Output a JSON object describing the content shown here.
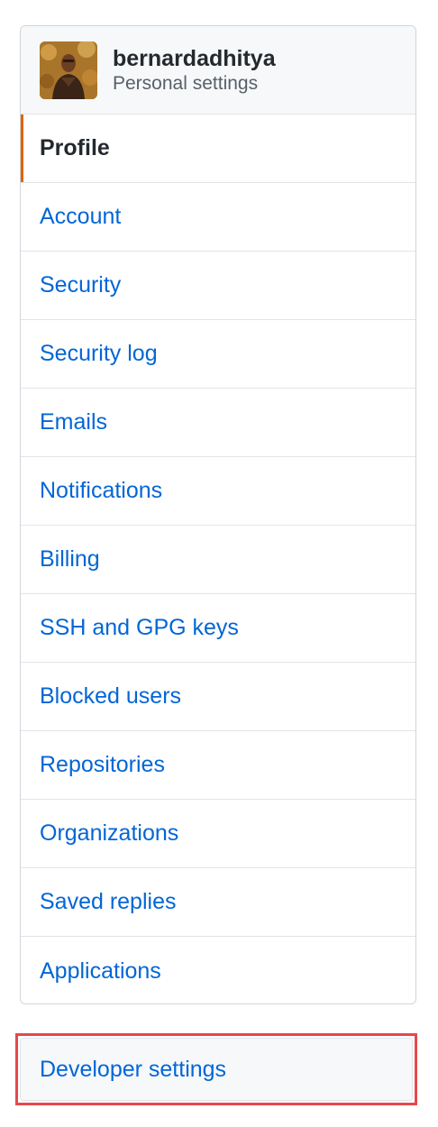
{
  "header": {
    "username": "bernardadhitya",
    "subtitle": "Personal settings",
    "avatar_icon": "user-avatar-photo"
  },
  "menu": {
    "items": [
      {
        "label": "Profile",
        "selected": true
      },
      {
        "label": "Account"
      },
      {
        "label": "Security"
      },
      {
        "label": "Security log"
      },
      {
        "label": "Emails"
      },
      {
        "label": "Notifications"
      },
      {
        "label": "Billing"
      },
      {
        "label": "SSH and GPG keys"
      },
      {
        "label": "Blocked users"
      },
      {
        "label": "Repositories"
      },
      {
        "label": "Organizations"
      },
      {
        "label": "Saved replies"
      },
      {
        "label": "Applications"
      }
    ]
  },
  "developer": {
    "label": "Developer settings"
  },
  "colors": {
    "link": "#0366d6",
    "selected_indicator": "#e36209",
    "highlight_border": "#e5484d",
    "header_bg": "#f6f8fa"
  }
}
